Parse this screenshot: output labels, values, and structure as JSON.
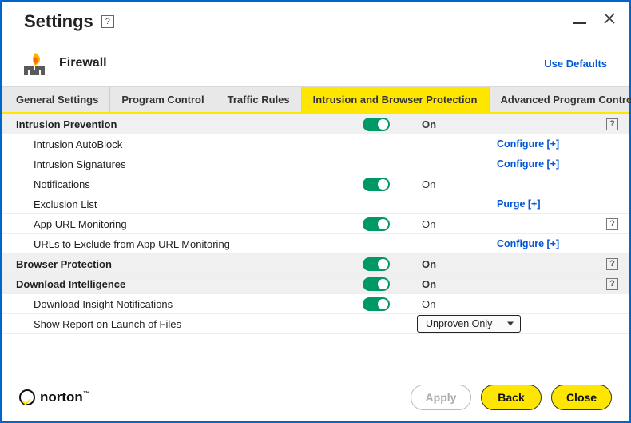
{
  "window": {
    "title": "Settings"
  },
  "section": {
    "name": "Firewall",
    "use_defaults": "Use Defaults"
  },
  "tabs": [
    "General Settings",
    "Program Control",
    "Traffic Rules",
    "Intrusion and Browser Protection",
    "Advanced Program Control"
  ],
  "active_tab_index": 3,
  "states": {
    "on": "On"
  },
  "actions": {
    "configure": "Configure [+]",
    "purge": "Purge [+]"
  },
  "rows": {
    "intrusion_prevention": "Intrusion Prevention",
    "intrusion_autoblock": "Intrusion AutoBlock",
    "intrusion_signatures": "Intrusion Signatures",
    "notifications": "Notifications",
    "exclusion_list": "Exclusion List",
    "app_url_monitoring": "App URL Monitoring",
    "urls_exclude": "URLs to Exclude from App URL Monitoring",
    "browser_protection": "Browser Protection",
    "download_intelligence": "Download Intelligence",
    "download_insight_notifications": "Download Insight Notifications",
    "show_report": "Show Report on Launch of Files"
  },
  "dropdown": {
    "show_report_value": "Unproven Only"
  },
  "footer": {
    "brand": "norton",
    "apply": "Apply",
    "back": "Back",
    "close": "Close"
  }
}
